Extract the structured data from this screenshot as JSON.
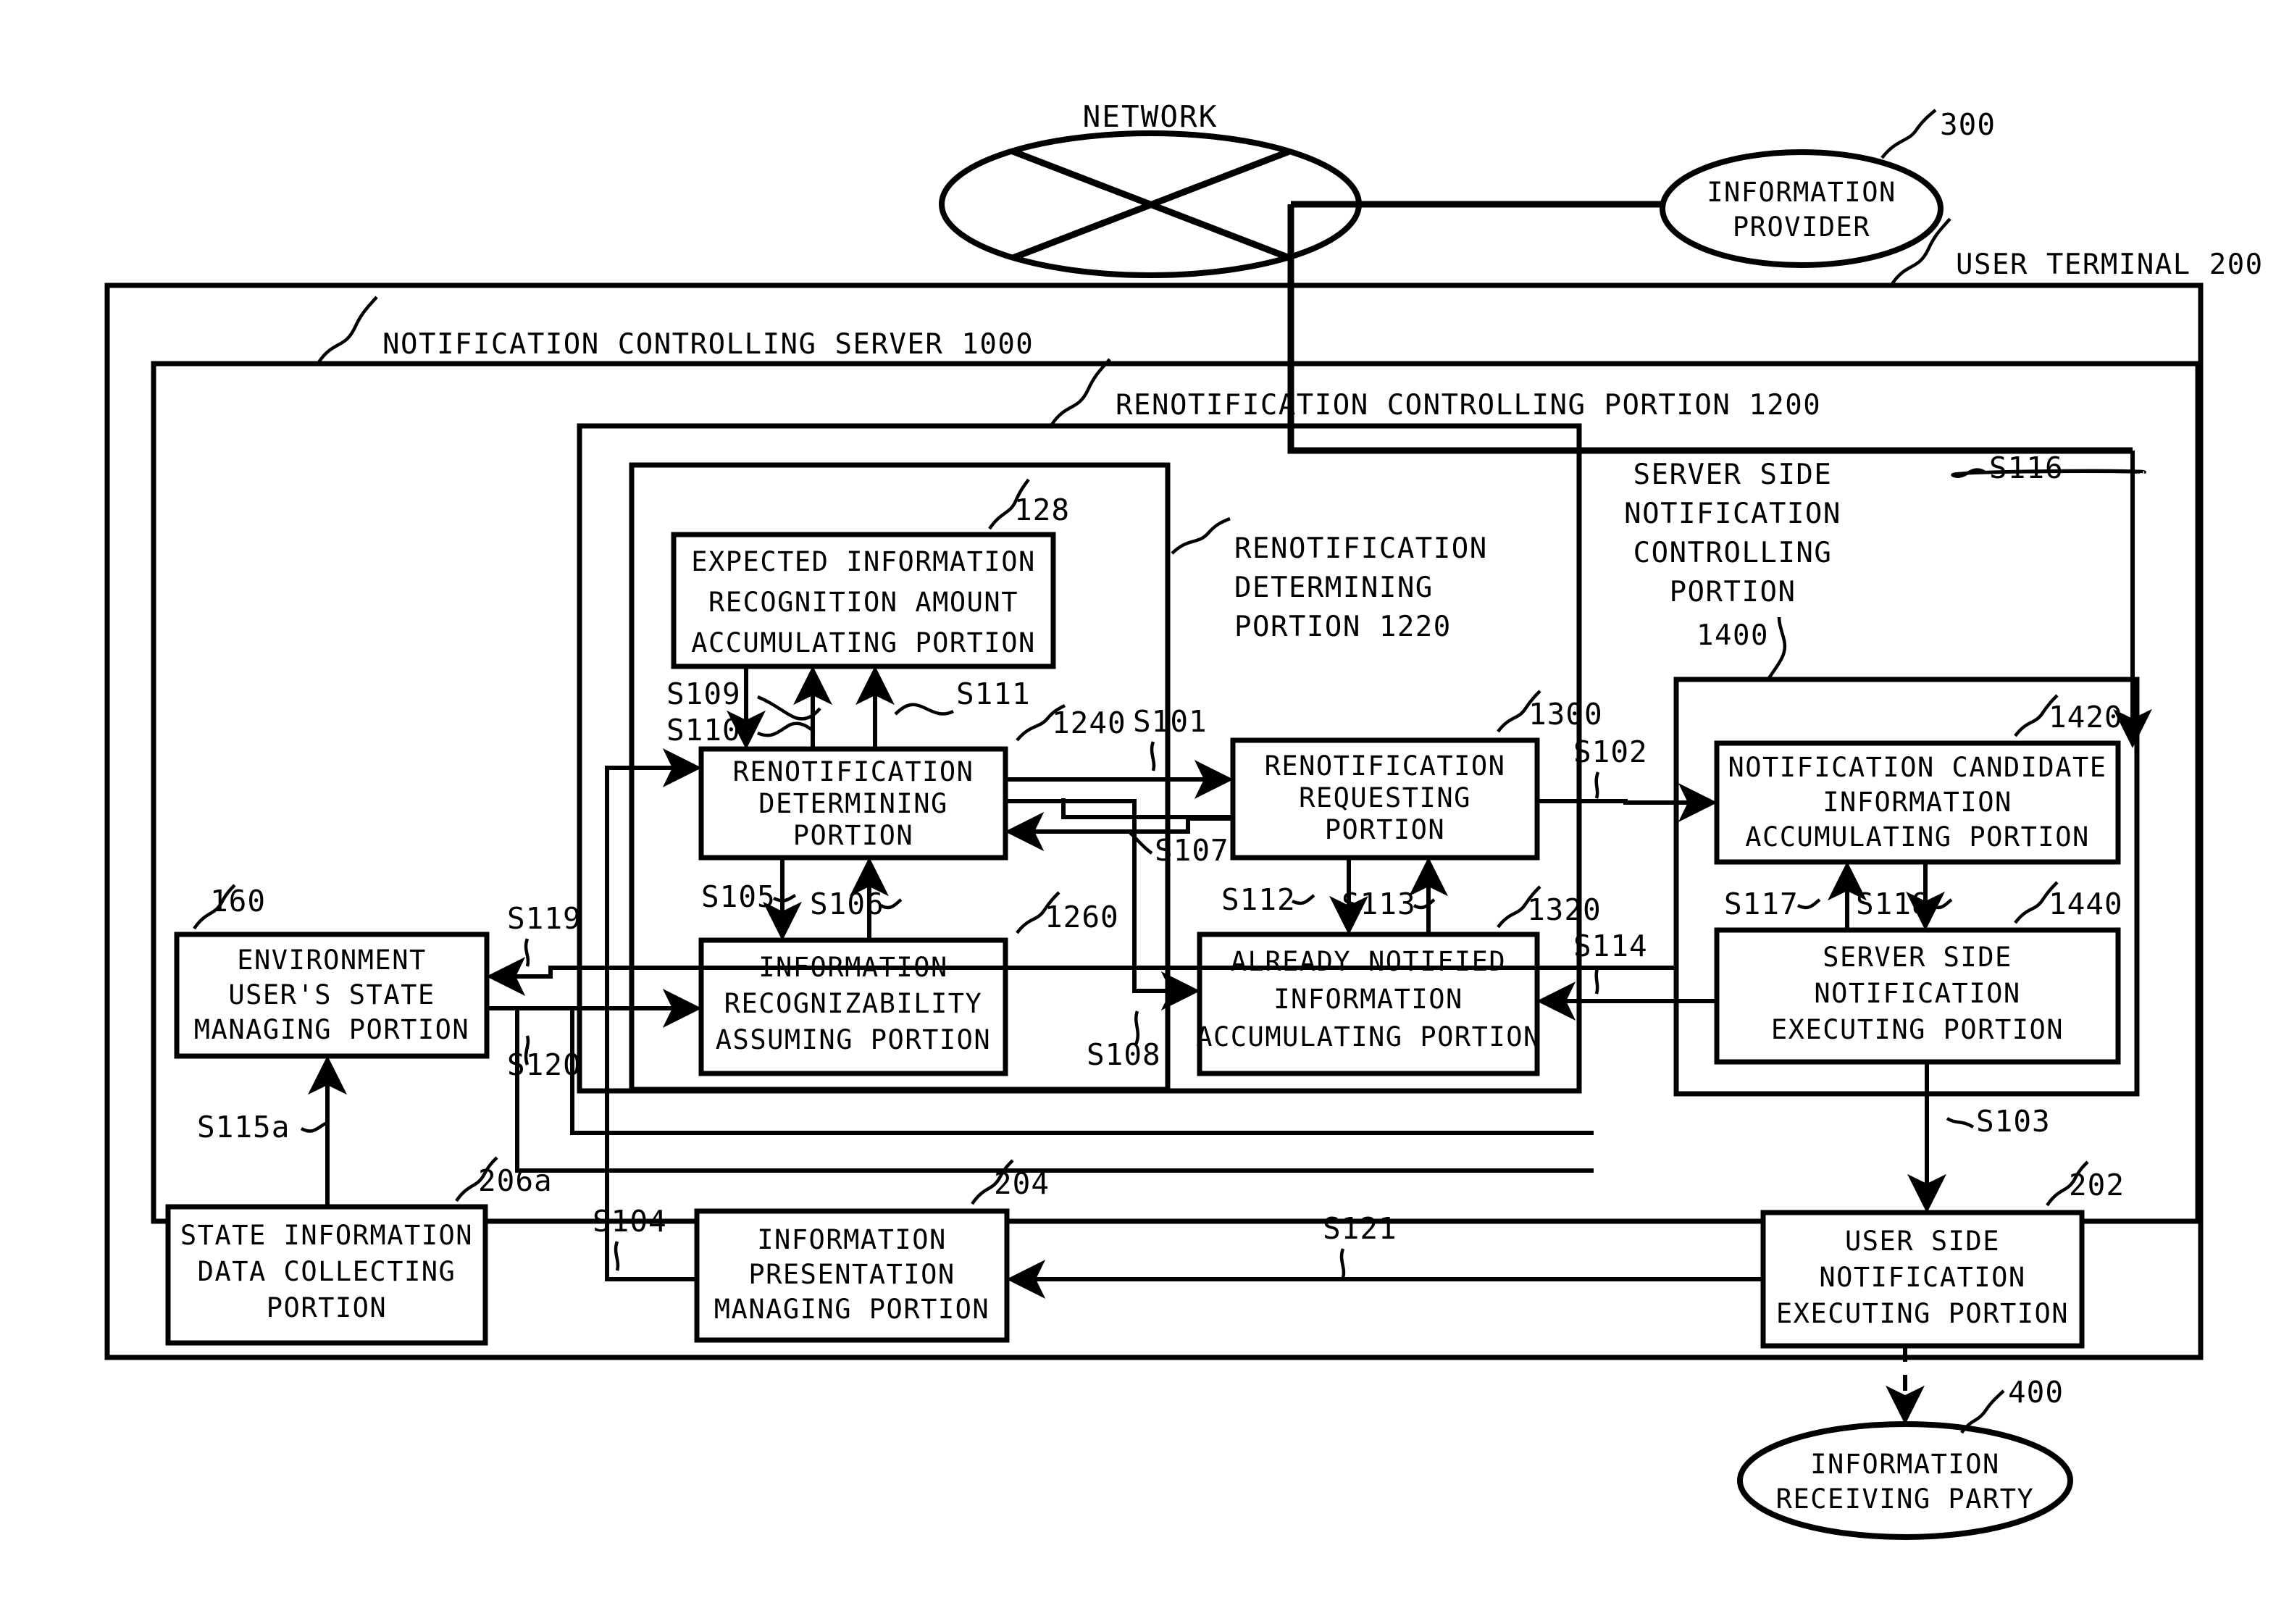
{
  "figure": {
    "network_label": "NETWORK",
    "outer_frames": [
      {
        "id": "user_terminal",
        "label": "USER TERMINAL 200"
      },
      {
        "id": "notification_server",
        "label": "NOTIFICATION CONTROLLING SERVER 1000"
      },
      {
        "id": "renotification_controlling",
        "label": "RENOTIFICATION CONTROLLING PORTION 1200"
      },
      {
        "id": "renotification_determining_group",
        "label": "RENOTIFICATION\nDETERMINING\nPORTION 1220"
      },
      {
        "id": "server_side_notification_controlling",
        "label": "SERVER SIDE\nNOTIFICATION\nCONTROLLING\nPORTION\n1400"
      }
    ],
    "group_labels": {
      "user_terminal": "USER TERMINAL 200",
      "server_1000": "NOTIFICATION CONTROLLING SERVER 1000",
      "renotif_1200": "RENOTIFICATION CONTROLLING PORTION 1200",
      "renotif_det_1220_l1": "RENOTIFICATION",
      "renotif_det_1220_l2": "DETERMINING",
      "renotif_det_1220_l3": "PORTION 1220",
      "server_side_1400_l1": "SERVER SIDE",
      "server_side_1400_l2": "NOTIFICATION",
      "server_side_1400_l3": "CONTROLLING",
      "server_side_1400_l4": "PORTION",
      "server_side_1400_l5": "1400"
    },
    "ellipses": [
      {
        "id": "network",
        "label": "NETWORK",
        "ref": ""
      },
      {
        "id": "information_provider",
        "line1": "INFORMATION",
        "line2": "PROVIDER",
        "ref": "300"
      },
      {
        "id": "information_receiving_party",
        "line1": "INFORMATION",
        "line2": "RECEIVING PARTY",
        "ref": "400"
      }
    ],
    "boxes": [
      {
        "id": "expected_info_recognition_amount",
        "ref": "128",
        "lines": [
          "EXPECTED INFORMATION",
          "RECOGNITION AMOUNT",
          "ACCUMULATING PORTION"
        ]
      },
      {
        "id": "renotification_determining",
        "ref": "1240",
        "lines": [
          "RENOTIFICATION",
          "DETERMINING",
          "PORTION"
        ]
      },
      {
        "id": "information_recognizability_assuming",
        "ref": "1260",
        "lines": [
          "INFORMATION",
          "RECOGNIZABILITY",
          "ASSUMING PORTION"
        ]
      },
      {
        "id": "renotification_requesting",
        "ref": "1300",
        "lines": [
          "RENOTIFICATION",
          "REQUESTING",
          "PORTION"
        ]
      },
      {
        "id": "already_notified_info_accumulating",
        "ref": "1320",
        "lines": [
          "ALREADY NOTIFIED",
          "INFORMATION",
          "ACCUMULATING PORTION"
        ]
      },
      {
        "id": "notification_candidate_info_accumulating",
        "ref": "1420",
        "lines": [
          "NOTIFICATION CANDIDATE",
          "INFORMATION",
          "ACCUMULATING PORTION"
        ]
      },
      {
        "id": "server_side_notification_executing",
        "ref": "1440",
        "lines": [
          "SERVER SIDE",
          "NOTIFICATION",
          "EXECUTING PORTION"
        ]
      },
      {
        "id": "environment_users_state_managing",
        "ref": "160",
        "lines": [
          "ENVIRONMENT",
          "USER'S STATE",
          "MANAGING PORTION"
        ]
      },
      {
        "id": "state_information_data_collecting",
        "ref": "206a",
        "lines": [
          "STATE INFORMATION",
          "DATA COLLECTING",
          "PORTION"
        ]
      },
      {
        "id": "information_presentation_managing",
        "ref": "204",
        "lines": [
          "INFORMATION",
          "PRESENTATION",
          "MANAGING PORTION"
        ]
      },
      {
        "id": "user_side_notification_executing",
        "ref": "202",
        "lines": [
          "USER SIDE",
          "NOTIFICATION",
          "EXECUTING PORTION"
        ]
      }
    ],
    "box_text": {
      "expected_l1": "EXPECTED INFORMATION",
      "expected_l2": "RECOGNITION AMOUNT",
      "expected_l3": "ACCUMULATING PORTION",
      "renotif_det_l1": "RENOTIFICATION",
      "renotif_det_l2": "DETERMINING",
      "renotif_det_l3": "PORTION",
      "info_recog_l1": "INFORMATION",
      "info_recog_l2": "RECOGNIZABILITY",
      "info_recog_l3": "ASSUMING PORTION",
      "renotif_req_l1": "RENOTIFICATION",
      "renotif_req_l2": "REQUESTING",
      "renotif_req_l3": "PORTION",
      "already_l1": "ALREADY NOTIFIED",
      "already_l2": "INFORMATION",
      "already_l3": "ACCUMULATING PORTION",
      "candidate_l1": "NOTIFICATION CANDIDATE",
      "candidate_l2": "INFORMATION",
      "candidate_l3": "ACCUMULATING PORTION",
      "srv_exec_l1": "SERVER SIDE",
      "srv_exec_l2": "NOTIFICATION",
      "srv_exec_l3": "EXECUTING PORTION",
      "env_l1": "ENVIRONMENT",
      "env_l2": "USER'S STATE",
      "env_l3": "MANAGING PORTION",
      "state_l1": "STATE INFORMATION",
      "state_l2": "DATA COLLECTING",
      "state_l3": "PORTION",
      "info_pres_l1": "INFORMATION",
      "info_pres_l2": "PRESENTATION",
      "info_pres_l3": "MANAGING PORTION",
      "user_exec_l1": "USER SIDE",
      "user_exec_l2": "NOTIFICATION",
      "user_exec_l3": "EXECUTING PORTION",
      "ip_l1": "INFORMATION",
      "ip_l2": "PROVIDER",
      "irp_l1": "INFORMATION",
      "irp_l2": "RECEIVING PARTY"
    },
    "reference_numerals": {
      "n128": "128",
      "n1240": "1240",
      "n1260": "1260",
      "n1300": "1300",
      "n1320": "1320",
      "n1420": "1420",
      "n1440": "1440",
      "n160": "160",
      "n206a": "206a",
      "n204": "204",
      "n202": "202",
      "n300": "300",
      "n400": "400"
    },
    "signals": {
      "S101": "S101",
      "S102": "S102",
      "S103": "S103",
      "S104": "S104",
      "S105": "S105",
      "S106": "S106",
      "S107": "S107",
      "S108": "S108",
      "S109": "S109",
      "S110": "S110",
      "S111": "S111",
      "S112": "S112",
      "S113": "S113",
      "S114": "S114",
      "S115a": "S115a",
      "S116": "S116",
      "S117": "S117",
      "S118": "S118",
      "S119": "S119",
      "S120": "S120",
      "S121": "S121"
    }
  }
}
